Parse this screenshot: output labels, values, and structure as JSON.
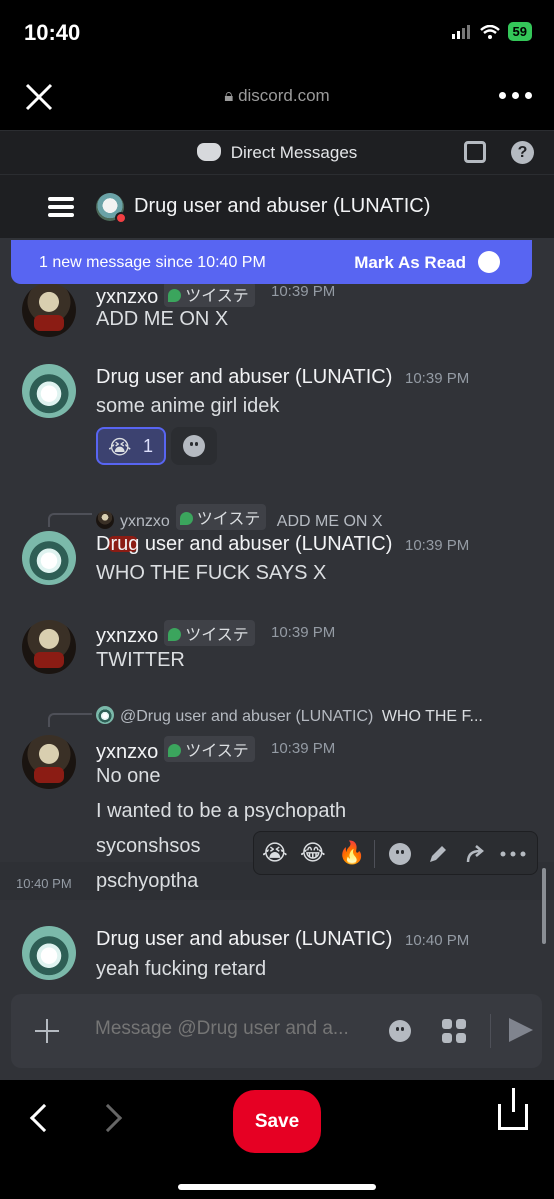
{
  "status": {
    "time": "10:40",
    "battery": "59"
  },
  "browser": {
    "url": "discord.com"
  },
  "header": {
    "title": "Direct Messages"
  },
  "channel": {
    "title": "Drug user and abuser (LUNATIC)"
  },
  "banner": {
    "text": "1 new message since 10:40 PM",
    "action": "Mark As Read"
  },
  "messages": [
    {
      "author": "yxnzxo",
      "tag": "ツイステ",
      "time": "10:39 PM",
      "lines": [
        "ADD ME ON X"
      ]
    },
    {
      "author": "Drug user and abuser (LUNATIC)",
      "time": "10:39 PM",
      "lines": [
        "some anime girl idek"
      ],
      "reaction": {
        "emoji": "😭",
        "count": "1"
      }
    },
    {
      "reply": {
        "author": "yxnzxo",
        "tag": "ツイステ",
        "text": "ADD ME ON X"
      },
      "author": "Drug user and abuser (LUNATIC)",
      "time": "10:39 PM",
      "lines": [
        "WHO THE FUCK SAYS X"
      ]
    },
    {
      "author": "yxnzxo",
      "tag": "ツイステ",
      "time": "10:39 PM",
      "lines": [
        "TWITTER"
      ]
    },
    {
      "reply": {
        "author": "@Drug user and abuser (LUNATIC)",
        "text": "WHO THE F..."
      },
      "author": "yxnzxo",
      "tag": "ツイステ",
      "time": "10:39 PM",
      "lines": [
        "No one",
        "I wanted to be a psychopath",
        "syconshsos",
        "pschyoptha"
      ],
      "hover_time": "10:40 PM"
    },
    {
      "author": "Drug user and abuser (LUNATIC)",
      "time": "10:40 PM",
      "lines": [
        "yeah fucking retard"
      ]
    }
  ],
  "toolbar": {
    "emojis": [
      "😭",
      "😂",
      "🔥"
    ],
    "icons": [
      "add-reaction-icon",
      "edit-icon",
      "forward-icon",
      "more-icon"
    ]
  },
  "composer": {
    "placeholder": "Message @Drug user and a..."
  },
  "bottom": {
    "save_label": "Save"
  }
}
